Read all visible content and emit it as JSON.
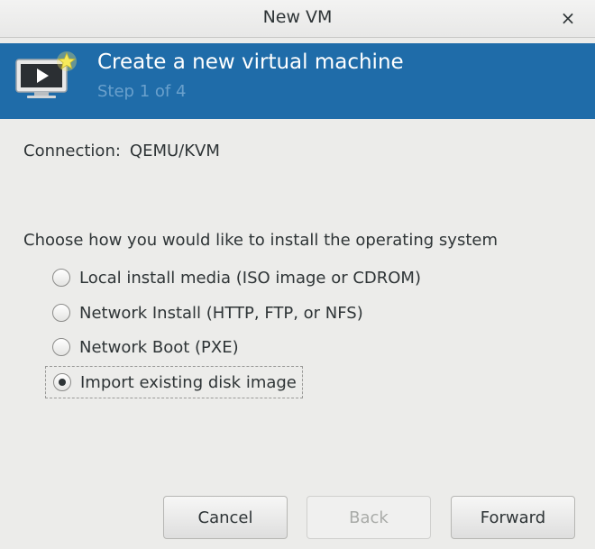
{
  "window": {
    "title": "New VM",
    "close_glyph": "×"
  },
  "banner": {
    "heading": "Create a new virtual machine",
    "step": "Step 1 of 4",
    "icon": "virtual-machine-new-icon",
    "background_color": "#1f6ca9"
  },
  "connection": {
    "label": "Connection:",
    "value": "QEMU/KVM"
  },
  "install": {
    "prompt": "Choose how you would like to install the operating system",
    "options": [
      {
        "label": "Local install media (ISO image or CDROM)",
        "selected": false
      },
      {
        "label": "Network Install (HTTP, FTP, or NFS)",
        "selected": false
      },
      {
        "label": "Network Boot (PXE)",
        "selected": false
      },
      {
        "label": "Import existing disk image",
        "selected": true
      }
    ]
  },
  "buttons": {
    "cancel": "Cancel",
    "back": "Back",
    "forward": "Forward",
    "back_enabled": false
  }
}
